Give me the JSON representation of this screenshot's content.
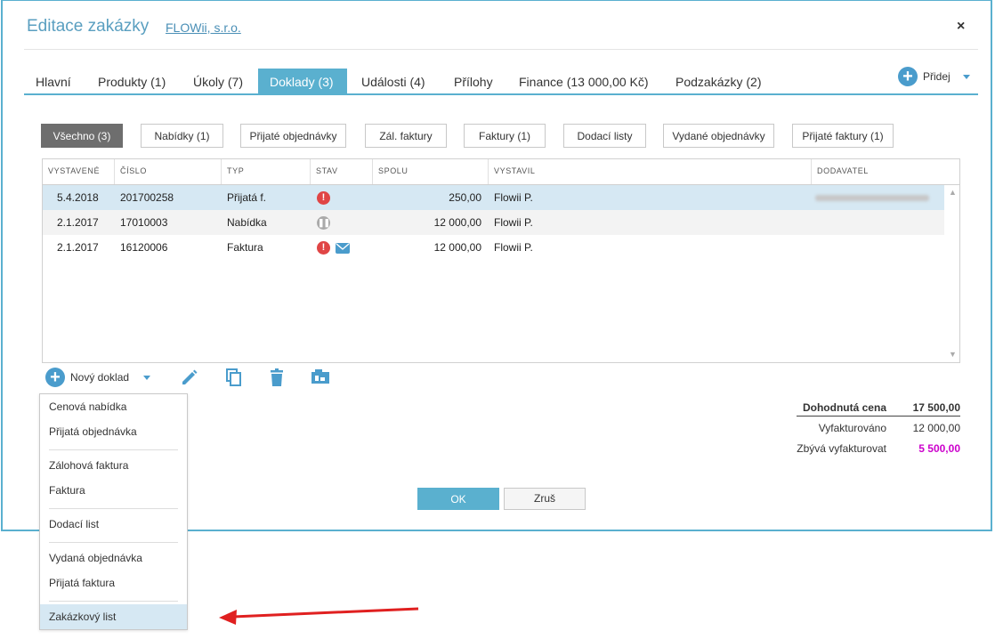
{
  "dialog": {
    "title": "Editace zakázky",
    "company": "FLOWii, s.r.o.",
    "close": "×"
  },
  "tabs": [
    {
      "label": "Hlavní"
    },
    {
      "label": "Produkty (1)"
    },
    {
      "label": "Úkoly (7)"
    },
    {
      "label": "Doklady (3)",
      "active": true
    },
    {
      "label": "Události (4)"
    },
    {
      "label": "Přílohy"
    },
    {
      "label": "Finance (13 000,00 Kč)"
    },
    {
      "label": "Podzakázky (2)"
    }
  ],
  "add_button": {
    "label": "Přidej",
    "icon": "plus-circle-icon"
  },
  "filters": [
    {
      "label": "Všechno (3)",
      "active": true
    },
    {
      "label": "Nabídky (1)"
    },
    {
      "label": "Přijaté objednávky"
    },
    {
      "label": "Zál. faktury"
    },
    {
      "label": "Faktury (1)"
    },
    {
      "label": "Dodací listy"
    },
    {
      "label": "Vydané objednávky"
    },
    {
      "label": "Přijaté faktury (1)"
    }
  ],
  "grid": {
    "columns": [
      "VYSTAVENÉ",
      "ČÍSLO",
      "TYP",
      "STAV",
      "SPOLU",
      "VYSTAVIL",
      "DODAVATEL"
    ],
    "rows": [
      {
        "date": "5.4.2018",
        "number": "201700258",
        "type": "Přijatá f.",
        "status": [
          "error-icon"
        ],
        "total": "250,00",
        "issued_by": "Flowii P.",
        "supplier_blurred": true,
        "selected": true
      },
      {
        "date": "2.1.2017",
        "number": "17010003",
        "type": "Nabídka",
        "status": [
          "pause-icon"
        ],
        "total": "12 000,00",
        "issued_by": "Flowii P.",
        "supplier_blurred": false
      },
      {
        "date": "2.1.2017",
        "number": "16120006",
        "type": "Faktura",
        "status": [
          "error-icon",
          "mail-icon"
        ],
        "total": "12 000,00",
        "issued_by": "Flowii P.",
        "supplier_blurred": false
      }
    ]
  },
  "toolbar": {
    "new_doc_label": "Nový doklad",
    "icons": [
      "pencil-icon",
      "copy-icon",
      "trash-icon",
      "print-icon"
    ]
  },
  "new_doc_menu": [
    {
      "label": "Cenová nabídka"
    },
    {
      "label": "Přijatá objednávka"
    },
    {
      "label": "Zálohová faktura"
    },
    {
      "label": "Faktura"
    },
    {
      "label": "Dodací list"
    },
    {
      "label": "Vydaná objednávka"
    },
    {
      "label": "Přijatá faktura"
    },
    {
      "label": "Zakázkový list",
      "highlighted": true
    }
  ],
  "totals": {
    "agreed_label": "Dohodnutá cena",
    "agreed_value": "17 500,00",
    "invoiced_label": "Vyfakturováno",
    "invoiced_value": "12 000,00",
    "remaining_label": "Zbývá vyfakturovat",
    "remaining_value": "5 500,00",
    "remaining_color": "#cc00cc"
  },
  "buttons": {
    "ok": "OK",
    "cancel": "Zruš"
  },
  "colors": {
    "accent": "#5ab0cf",
    "error": "#e04545",
    "arrow": "#e02020"
  }
}
